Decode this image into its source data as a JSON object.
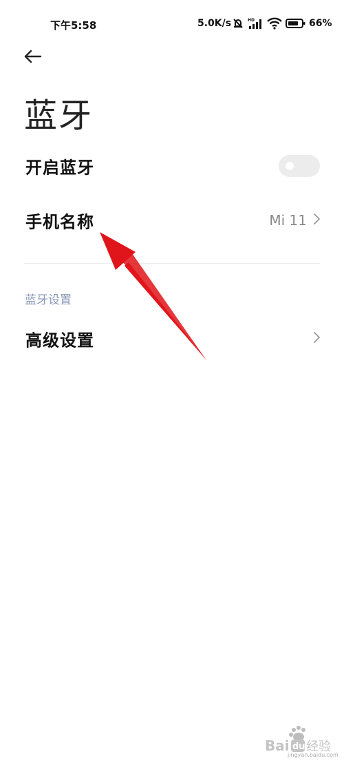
{
  "status_bar": {
    "time": "下午5:58",
    "net_speed": "5.0K/s",
    "battery_percent": "66%",
    "icons": [
      "mute-bell-icon",
      "hd-signal-icon",
      "wifi-icon",
      "battery-icon"
    ]
  },
  "header": {
    "back_icon": "back-arrow-icon",
    "title": "蓝牙"
  },
  "settings": {
    "bluetooth_toggle": {
      "label": "开启蓝牙",
      "on": false
    },
    "device_name": {
      "label": "手机名称",
      "value": "Mi 11"
    },
    "section_header": "蓝牙设置",
    "advanced": {
      "label": "高级设置"
    }
  },
  "annotation": {
    "type": "arrow",
    "color": "#e0151b",
    "points_to": "device-name-row"
  },
  "watermark": {
    "text": "Baidu经验",
    "url_text": "jingyan.baidu.com"
  },
  "colors": {
    "background": "#ffffff",
    "toggle_off": "#ececec",
    "section_header": "#8a97b5",
    "secondary_text": "#888888"
  }
}
